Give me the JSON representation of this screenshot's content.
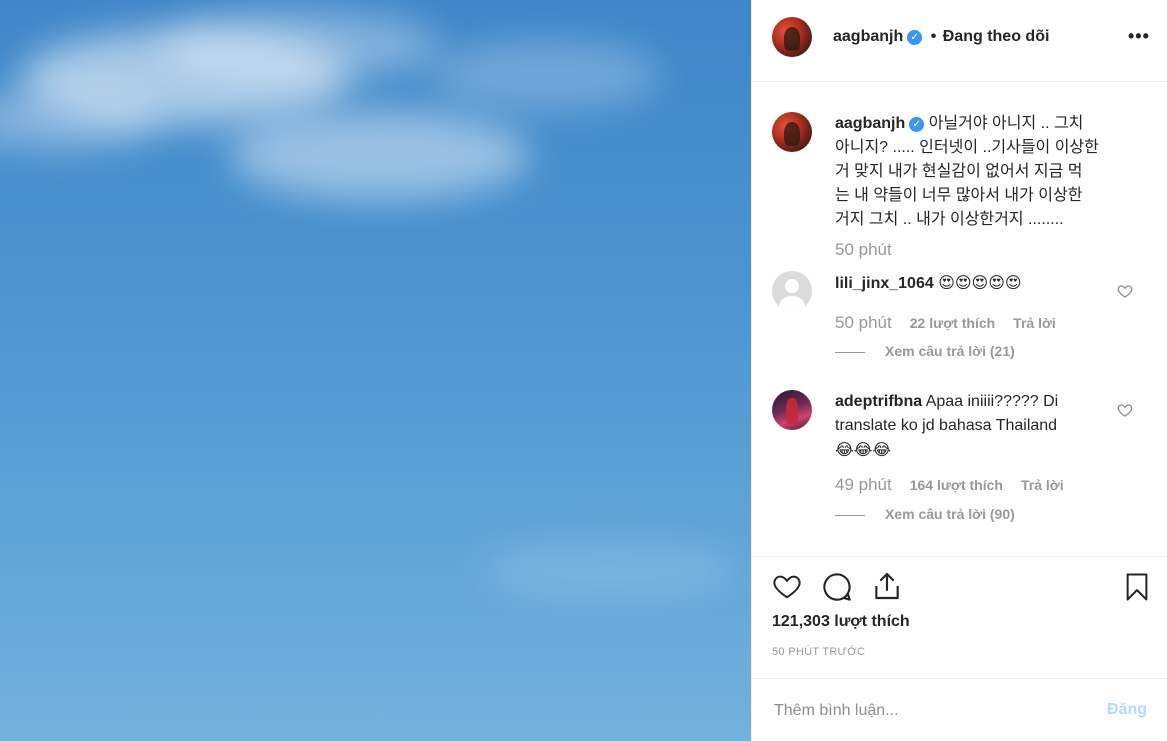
{
  "header": {
    "username": "aagbanjh",
    "separator": "•",
    "follow_label": "Đang theo dõi",
    "more_label": "•••"
  },
  "caption": {
    "username": "aagbanjh",
    "text": "아닐거야 아니지 .. 그치 아니지? ..... 인터넷이 ..기사들이 이상한거 맞지 내가 현실감이 없어서 지금 먹는 내 약들이 너무 많아서 내가 이상한거지 그치 .. 내가 이상한거지 ........",
    "line1": "아닐거야 아니지 .. 그치",
    "line2": "아니지? ..... 인터넷이 ..기사들이 이상한",
    "line3": "거 맞지 내가 현실감이 없어서 지금 먹",
    "line4": "는 내 약들이 너무 많아서 내가 이상한",
    "line5": "거지 그치 .. 내가 이상한거지 ........",
    "time": "50 phút"
  },
  "comments": [
    {
      "username": "lili_jinx_1064",
      "text": "😍😍😍😍😍",
      "time": "50 phút",
      "likes": "22 lượt thích",
      "reply": "Trả lời",
      "view_replies": "Xem câu trả lời (21)"
    },
    {
      "username": "adeptrifbna",
      "text_line1": "Apaa iniiii????? Di",
      "text_line2": "translate ko jd bahasa Thailand",
      "text_line3": "😂😂😂",
      "time": "49 phút",
      "likes": "164 lượt thích",
      "reply": "Trả lời",
      "view_replies": "Xem câu trả lời (90)"
    }
  ],
  "post": {
    "likes": "121,303 lượt thích",
    "time_ago": "50 PHÚT TRƯỚC"
  },
  "add_comment": {
    "placeholder": "Thêm bình luận...",
    "post_label": "Đăng"
  },
  "colors": {
    "verified": "#3897f0",
    "post_disabled": "#b3dbff",
    "muted": "#999999",
    "sky": "#4a93cf"
  },
  "icons": [
    "verified-badge-icon",
    "more-options-icon",
    "heart-icon",
    "comment-icon",
    "share-icon",
    "bookmark-icon"
  ]
}
